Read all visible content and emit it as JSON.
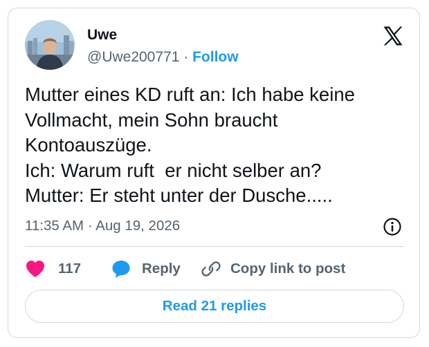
{
  "author": {
    "name": "Uwe",
    "handle": "@Uwe200771",
    "separator": " · ",
    "follow_label": "Follow",
    "avatar_icon": "user-avatar-photo"
  },
  "logo": {
    "icon": "x-logo-icon"
  },
  "tweet": {
    "lines": [
      "Mutter eines KD ruft an: Ich habe keine",
      "Vollmacht, mein Sohn braucht",
      "Kontoauszüge.",
      "Ich: Warum ruft  er nicht selber an?",
      "Mutter: Er steht unter der Dusche....."
    ],
    "timestamp": "11:35 AM · Aug 19, 2026"
  },
  "actions": {
    "like_count": "117",
    "reply_label": "Reply",
    "copy_label": "Copy link to post"
  },
  "read_replies_label": "Read 21 replies",
  "colors": {
    "accent": "#1d9bf0",
    "like": "#f91880",
    "text": "#0f1419",
    "muted": "#536471",
    "border": "#cfd9de"
  }
}
